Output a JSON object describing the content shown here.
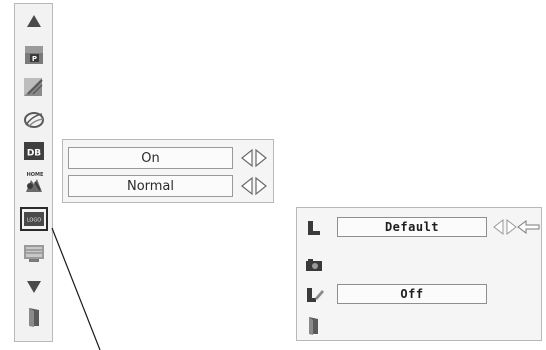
{
  "left_menu": {
    "items": [
      {
        "icon": "scroll-up-arrow-icon"
      },
      {
        "icon": "p-image-icon"
      },
      {
        "icon": "image-adjust-icon"
      },
      {
        "icon": "screen-icon"
      },
      {
        "icon": "db-icon",
        "text": "DB"
      },
      {
        "icon": "home-setting-icon",
        "text": "HOME"
      },
      {
        "icon": "logo-icon",
        "text": "LOGO",
        "selected": true
      },
      {
        "icon": "pc-adjust-icon"
      },
      {
        "icon": "scroll-down-arrow-icon"
      },
      {
        "icon": "exit-door-icon"
      }
    ]
  },
  "middle_panel": {
    "rows": [
      {
        "value": "On"
      },
      {
        "value": "Normal"
      }
    ]
  },
  "right_panel": {
    "rows": [
      {
        "icon": "l-shape-icon",
        "value": "Default",
        "has_arrows": true,
        "has_back_arrow": true
      },
      {
        "icon": "camera-icon"
      },
      {
        "icon": "lock-pen-icon",
        "value": "Off"
      },
      {
        "icon": "exit-door-icon"
      }
    ]
  },
  "colors": {
    "icon_dark": "#3a3a3a",
    "icon_mid": "#7a7a7a",
    "panel_bg": "#f5f5f5",
    "border": "#b8b8b8"
  }
}
